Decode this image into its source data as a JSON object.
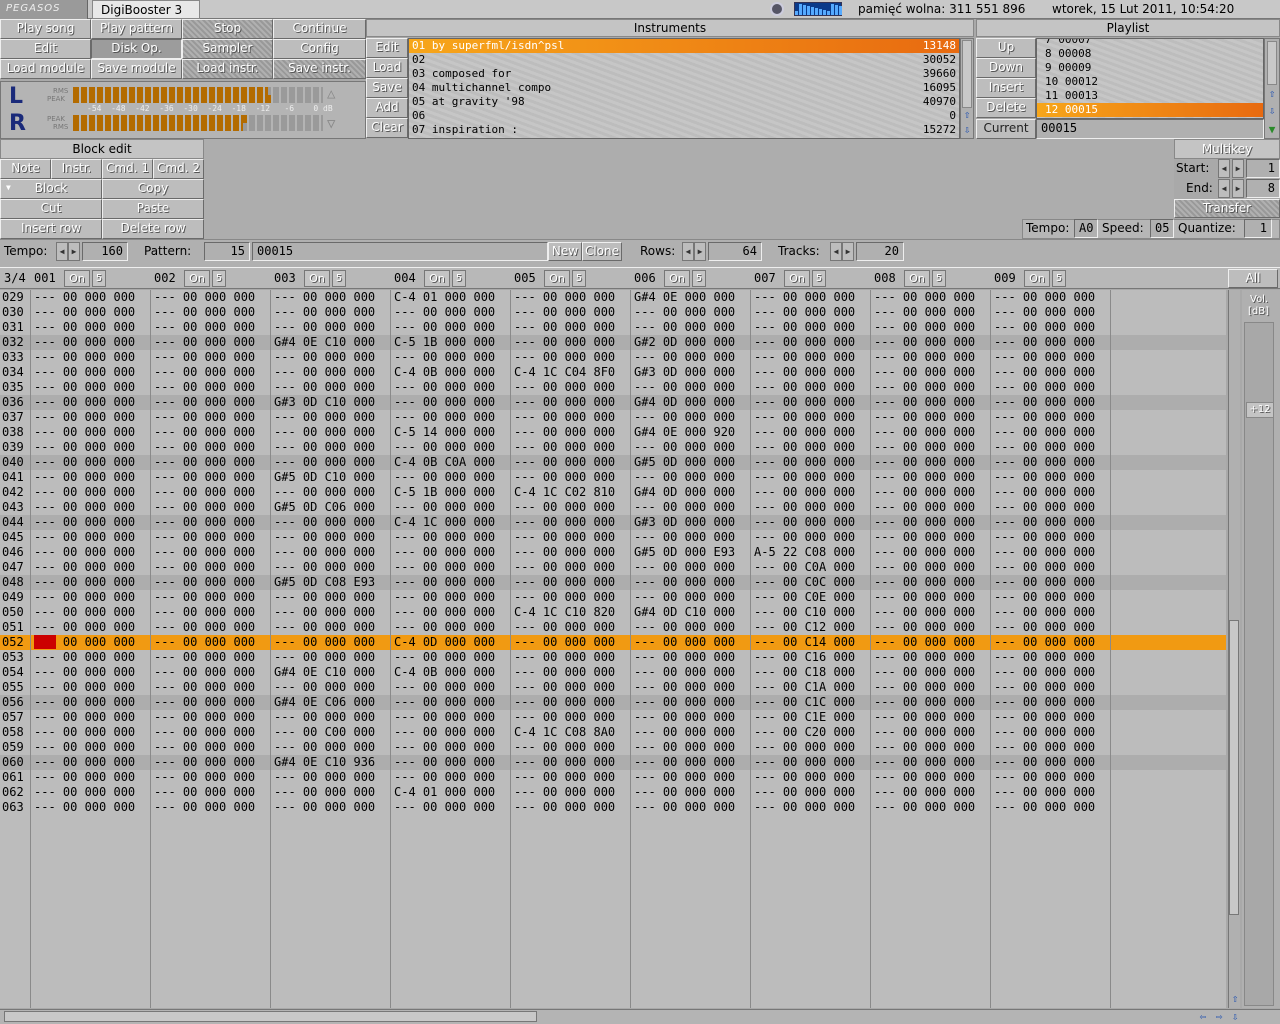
{
  "titlebar": {
    "logo": "PEGASOS",
    "app_title": "DigiBooster 3",
    "memory": "pamięć wolna: 311 551 896",
    "clock": "wtorek, 15 Lut 2011, 10:54:20"
  },
  "toolbar": {
    "row1": [
      "Play song",
      "Play pattern",
      "Stop",
      "Continue"
    ],
    "row2": [
      "Edit",
      "Disk Op.",
      "Sampler",
      "Config"
    ],
    "row3": [
      "Load module",
      "Save module",
      "Load instr.",
      "Save instr."
    ]
  },
  "vu": {
    "left": "L",
    "right": "R",
    "rms": "RMS",
    "peak": "PEAK",
    "scale": "-54  -48  -42  -36  -30  -24  -18  -12   -6    0 dB",
    "left_rms_level": 0.78,
    "left_peak_level": 0.8,
    "right_peak_level": 0.7,
    "right_rms_level": 0.68
  },
  "instruments": {
    "title": "Instruments",
    "buttons": [
      "Edit",
      "Load",
      "Save",
      "Add",
      "Clear"
    ],
    "items": [
      {
        "name": "01 by superfml/isdn^psl",
        "size": "13148",
        "selected": true
      },
      {
        "name": "02",
        "size": "30052"
      },
      {
        "name": "03 composed for",
        "size": "39660"
      },
      {
        "name": "04 multichannel compo",
        "size": "16095"
      },
      {
        "name": "05 at gravity '98",
        "size": "40970"
      },
      {
        "name": "06",
        "size": "0"
      },
      {
        "name": "07 inspiration :",
        "size": "15272"
      }
    ]
  },
  "playlist": {
    "title": "Playlist",
    "buttons": [
      "Up",
      "Down",
      "Insert",
      "Delete"
    ],
    "current_label": "Current",
    "current_value": "00015",
    "items": [
      {
        "text": "7 00007"
      },
      {
        "text": "8 00008"
      },
      {
        "text": "9 00009"
      },
      {
        "text": "10 00012"
      },
      {
        "text": "11 00013"
      },
      {
        "text": "12 00015",
        "selected": true
      }
    ]
  },
  "block_edit": {
    "title": "Block edit",
    "buttons": [
      "Note",
      "Instr.",
      "Cmd. 1",
      "Cmd. 2",
      "Block",
      "Copy",
      "Cut",
      "Paste",
      "Insert row",
      "Delete row"
    ]
  },
  "multikey": {
    "title": "Multikey",
    "start_label": "Start:",
    "start_value": "1",
    "end_label": "End:",
    "end_value": "8",
    "transfer": "Transfer"
  },
  "status": {
    "tempo_label": "Tempo:",
    "tempo_value": "A0",
    "speed_label": "Speed:",
    "speed_value": "05",
    "quantize_label": "Quantize:",
    "quantize_value": "1"
  },
  "pattern_bar": {
    "tempo_label": "Tempo:",
    "tempo_value": "160",
    "pattern_label": "Pattern:",
    "pattern_num": "15",
    "pattern_name": "00015",
    "new_btn": "New",
    "clone_btn": "Clone",
    "rows_label": "Rows:",
    "rows_value": "64",
    "tracks_label": "Tracks:",
    "tracks_value": "20"
  },
  "track_header": {
    "beat": "3/4",
    "tracks": [
      "001",
      "002",
      "003",
      "004",
      "005",
      "006",
      "007",
      "008",
      "009"
    ],
    "on_label": "On",
    "vol_label": "5",
    "all_btn": "All"
  },
  "vol_panel": {
    "vol_label": "Vol.",
    "db_label": "[dB]",
    "gain": "+12"
  },
  "pattern": {
    "current_row": "052",
    "rows": [
      {
        "n": "029",
        "c": [
          "--- 00 000 000",
          "--- 00 000 000",
          "--- 00 000 000",
          "C-4 01 000 000",
          "--- 00 000 000",
          "G#4 0E 000 000",
          "--- 00 000 000",
          "--- 00 000 000",
          "--- 00 000 000"
        ]
      },
      {
        "n": "030",
        "c": [
          "--- 00 000 000",
          "--- 00 000 000",
          "--- 00 000 000",
          "--- 00 000 000",
          "--- 00 000 000",
          "--- 00 000 000",
          "--- 00 000 000",
          "--- 00 000 000",
          "--- 00 000 000"
        ]
      },
      {
        "n": "031",
        "c": [
          "--- 00 000 000",
          "--- 00 000 000",
          "--- 00 000 000",
          "--- 00 000 000",
          "--- 00 000 000",
          "--- 00 000 000",
          "--- 00 000 000",
          "--- 00 000 000",
          "--- 00 000 000"
        ]
      },
      {
        "n": "032",
        "c": [
          "--- 00 000 000",
          "--- 00 000 000",
          "G#4 0E C10 000",
          "C-5 1B 000 000",
          "--- 00 000 000",
          "G#2 0D 000 000",
          "--- 00 000 000",
          "--- 00 000 000",
          "--- 00 000 000"
        ]
      },
      {
        "n": "033",
        "c": [
          "--- 00 000 000",
          "--- 00 000 000",
          "--- 00 000 000",
          "--- 00 000 000",
          "--- 00 000 000",
          "--- 00 000 000",
          "--- 00 000 000",
          "--- 00 000 000",
          "--- 00 000 000"
        ]
      },
      {
        "n": "034",
        "c": [
          "--- 00 000 000",
          "--- 00 000 000",
          "--- 00 000 000",
          "C-4 0B 000 000",
          "C-4 1C C04 8F0",
          "G#3 0D 000 000",
          "--- 00 000 000",
          "--- 00 000 000",
          "--- 00 000 000"
        ]
      },
      {
        "n": "035",
        "c": [
          "--- 00 000 000",
          "--- 00 000 000",
          "--- 00 000 000",
          "--- 00 000 000",
          "--- 00 000 000",
          "--- 00 000 000",
          "--- 00 000 000",
          "--- 00 000 000",
          "--- 00 000 000"
        ]
      },
      {
        "n": "036",
        "c": [
          "--- 00 000 000",
          "--- 00 000 000",
          "G#3 0D C10 000",
          "--- 00 000 000",
          "--- 00 000 000",
          "G#4 0D 000 000",
          "--- 00 000 000",
          "--- 00 000 000",
          "--- 00 000 000"
        ]
      },
      {
        "n": "037",
        "c": [
          "--- 00 000 000",
          "--- 00 000 000",
          "--- 00 000 000",
          "--- 00 000 000",
          "--- 00 000 000",
          "--- 00 000 000",
          "--- 00 000 000",
          "--- 00 000 000",
          "--- 00 000 000"
        ]
      },
      {
        "n": "038",
        "c": [
          "--- 00 000 000",
          "--- 00 000 000",
          "--- 00 000 000",
          "C-5 14 000 000",
          "--- 00 000 000",
          "G#4 0E 000 920",
          "--- 00 000 000",
          "--- 00 000 000",
          "--- 00 000 000"
        ]
      },
      {
        "n": "039",
        "c": [
          "--- 00 000 000",
          "--- 00 000 000",
          "--- 00 000 000",
          "--- 00 000 000",
          "--- 00 000 000",
          "--- 00 000 000",
          "--- 00 000 000",
          "--- 00 000 000",
          "--- 00 000 000"
        ]
      },
      {
        "n": "040",
        "c": [
          "--- 00 000 000",
          "--- 00 000 000",
          "--- 00 000 000",
          "C-4 0B C0A 000",
          "--- 00 000 000",
          "G#5 0D 000 000",
          "--- 00 000 000",
          "--- 00 000 000",
          "--- 00 000 000"
        ]
      },
      {
        "n": "041",
        "c": [
          "--- 00 000 000",
          "--- 00 000 000",
          "G#5 0D C10 000",
          "--- 00 000 000",
          "--- 00 000 000",
          "--- 00 000 000",
          "--- 00 000 000",
          "--- 00 000 000",
          "--- 00 000 000"
        ]
      },
      {
        "n": "042",
        "c": [
          "--- 00 000 000",
          "--- 00 000 000",
          "--- 00 000 000",
          "C-5 1B 000 000",
          "C-4 1C C02 810",
          "G#4 0D 000 000",
          "--- 00 000 000",
          "--- 00 000 000",
          "--- 00 000 000"
        ]
      },
      {
        "n": "043",
        "c": [
          "--- 00 000 000",
          "--- 00 000 000",
          "G#5 0D C06 000",
          "--- 00 000 000",
          "--- 00 000 000",
          "--- 00 000 000",
          "--- 00 000 000",
          "--- 00 000 000",
          "--- 00 000 000"
        ]
      },
      {
        "n": "044",
        "c": [
          "--- 00 000 000",
          "--- 00 000 000",
          "--- 00 000 000",
          "C-4 1C 000 000",
          "--- 00 000 000",
          "G#3 0D 000 000",
          "--- 00 000 000",
          "--- 00 000 000",
          "--- 00 000 000"
        ]
      },
      {
        "n": "045",
        "c": [
          "--- 00 000 000",
          "--- 00 000 000",
          "--- 00 000 000",
          "--- 00 000 000",
          "--- 00 000 000",
          "--- 00 000 000",
          "--- 00 000 000",
          "--- 00 000 000",
          "--- 00 000 000"
        ]
      },
      {
        "n": "046",
        "c": [
          "--- 00 000 000",
          "--- 00 000 000",
          "--- 00 000 000",
          "--- 00 000 000",
          "--- 00 000 000",
          "G#5 0D 000 E93",
          "A-5 22 C08 000",
          "--- 00 000 000",
          "--- 00 000 000"
        ]
      },
      {
        "n": "047",
        "c": [
          "--- 00 000 000",
          "--- 00 000 000",
          "--- 00 000 000",
          "--- 00 000 000",
          "--- 00 000 000",
          "--- 00 000 000",
          "--- 00 C0A 000",
          "--- 00 000 000",
          "--- 00 000 000"
        ]
      },
      {
        "n": "048",
        "c": [
          "--- 00 000 000",
          "--- 00 000 000",
          "G#5 0D C08 E93",
          "--- 00 000 000",
          "--- 00 000 000",
          "--- 00 000 000",
          "--- 00 C0C 000",
          "--- 00 000 000",
          "--- 00 000 000"
        ]
      },
      {
        "n": "049",
        "c": [
          "--- 00 000 000",
          "--- 00 000 000",
          "--- 00 000 000",
          "--- 00 000 000",
          "--- 00 000 000",
          "--- 00 000 000",
          "--- 00 C0E 000",
          "--- 00 000 000",
          "--- 00 000 000"
        ]
      },
      {
        "n": "050",
        "c": [
          "--- 00 000 000",
          "--- 00 000 000",
          "--- 00 000 000",
          "--- 00 000 000",
          "C-4 1C C10 820",
          "G#4 0D C10 000",
          "--- 00 C10 000",
          "--- 00 000 000",
          "--- 00 000 000"
        ]
      },
      {
        "n": "051",
        "c": [
          "--- 00 000 000",
          "--- 00 000 000",
          "--- 00 000 000",
          "--- 00 000 000",
          "--- 00 000 000",
          "--- 00 000 000",
          "--- 00 C12 000",
          "--- 00 000 000",
          "--- 00 000 000"
        ]
      },
      {
        "n": "052",
        "c": [
          "--- 00 000 000",
          "--- 00 000 000",
          "--- 00 000 000",
          "C-4 0D 000 000",
          "--- 00 000 000",
          "--- 00 000 000",
          "--- 00 C14 000",
          "--- 00 000 000",
          "--- 00 000 000"
        ]
      },
      {
        "n": "053",
        "c": [
          "--- 00 000 000",
          "--- 00 000 000",
          "--- 00 000 000",
          "--- 00 000 000",
          "--- 00 000 000",
          "--- 00 000 000",
          "--- 00 C16 000",
          "--- 00 000 000",
          "--- 00 000 000"
        ]
      },
      {
        "n": "054",
        "c": [
          "--- 00 000 000",
          "--- 00 000 000",
          "G#4 0E C10 000",
          "C-4 0B 000 000",
          "--- 00 000 000",
          "--- 00 000 000",
          "--- 00 C18 000",
          "--- 00 000 000",
          "--- 00 000 000"
        ]
      },
      {
        "n": "055",
        "c": [
          "--- 00 000 000",
          "--- 00 000 000",
          "--- 00 000 000",
          "--- 00 000 000",
          "--- 00 000 000",
          "--- 00 000 000",
          "--- 00 C1A 000",
          "--- 00 000 000",
          "--- 00 000 000"
        ]
      },
      {
        "n": "056",
        "c": [
          "--- 00 000 000",
          "--- 00 000 000",
          "G#4 0E C06 000",
          "--- 00 000 000",
          "--- 00 000 000",
          "--- 00 000 000",
          "--- 00 C1C 000",
          "--- 00 000 000",
          "--- 00 000 000"
        ]
      },
      {
        "n": "057",
        "c": [
          "--- 00 000 000",
          "--- 00 000 000",
          "--- 00 000 000",
          "--- 00 000 000",
          "--- 00 000 000",
          "--- 00 000 000",
          "--- 00 C1E 000",
          "--- 00 000 000",
          "--- 00 000 000"
        ]
      },
      {
        "n": "058",
        "c": [
          "--- 00 000 000",
          "--- 00 000 000",
          "--- 00 C00 000",
          "--- 00 000 000",
          "C-4 1C C08 8A0",
          "--- 00 000 000",
          "--- 00 C20 000",
          "--- 00 000 000",
          "--- 00 000 000"
        ]
      },
      {
        "n": "059",
        "c": [
          "--- 00 000 000",
          "--- 00 000 000",
          "--- 00 000 000",
          "--- 00 000 000",
          "--- 00 000 000",
          "--- 00 000 000",
          "--- 00 000 000",
          "--- 00 000 000",
          "--- 00 000 000"
        ]
      },
      {
        "n": "060",
        "c": [
          "--- 00 000 000",
          "--- 00 000 000",
          "G#4 0E C10 936",
          "--- 00 000 000",
          "--- 00 000 000",
          "--- 00 000 000",
          "--- 00 000 000",
          "--- 00 000 000",
          "--- 00 000 000"
        ]
      },
      {
        "n": "061",
        "c": [
          "--- 00 000 000",
          "--- 00 000 000",
          "--- 00 000 000",
          "--- 00 000 000",
          "--- 00 000 000",
          "--- 00 000 000",
          "--- 00 000 000",
          "--- 00 000 000",
          "--- 00 000 000"
        ]
      },
      {
        "n": "062",
        "c": [
          "--- 00 000 000",
          "--- 00 000 000",
          "--- 00 000 000",
          "C-4 01 000 000",
          "--- 00 000 000",
          "--- 00 000 000",
          "--- 00 000 000",
          "--- 00 000 000",
          "--- 00 000 000"
        ]
      },
      {
        "n": "063",
        "c": [
          "--- 00 000 000",
          "--- 00 000 000",
          "--- 00 000 000",
          "--- 00 000 000",
          "--- 00 000 000",
          "--- 00 000 000",
          "--- 00 000 000",
          "--- 00 000 000",
          "--- 00 000 000"
        ]
      }
    ]
  },
  "colors": {
    "accent": "#f19a12",
    "cursor": "#cc0000",
    "vu": "#b36b00",
    "channel": "#1a2a7a"
  }
}
